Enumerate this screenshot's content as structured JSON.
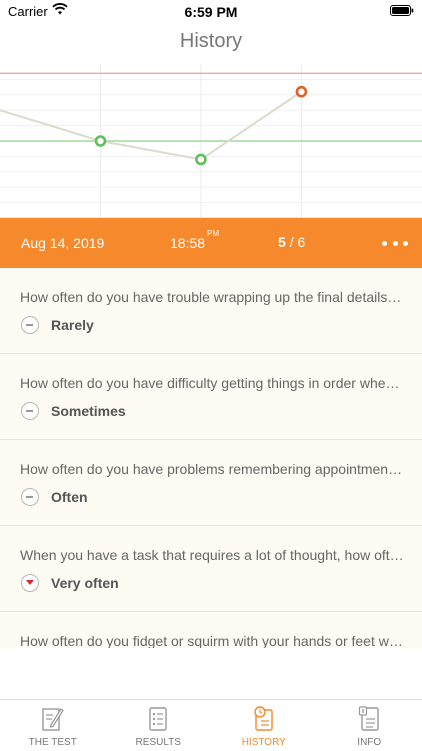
{
  "status_bar": {
    "carrier": "Carrier",
    "time": "6:59 PM"
  },
  "header": {
    "title": "History"
  },
  "chart_data": {
    "type": "line",
    "x": [
      0,
      1,
      2,
      3
    ],
    "values": [
      2,
      1.4,
      3.6
    ],
    "points": [
      {
        "x": 1,
        "y": 2,
        "color": "#5cc05c"
      },
      {
        "x": 2,
        "y": 1.4,
        "color": "#5cc05c"
      },
      {
        "x": 3,
        "y": 3.6,
        "color": "#e0622a"
      }
    ],
    "start_y": 3.0,
    "ylim": [
      -0.5,
      4.5
    ],
    "xlim": [
      0,
      4.2
    ],
    "reference_lines": [
      {
        "y": 4.2,
        "color": "#f0a090"
      },
      {
        "y": 2.0,
        "color": "#8fd08f"
      }
    ],
    "grid": true
  },
  "session": {
    "date": "Aug 14, 2019",
    "time": "18:58",
    "time_suffix": "PM",
    "score_value": "5",
    "score_total": "/ 6"
  },
  "questions": [
    {
      "text": "How often do you have trouble wrapping up the final details of a project, once the challenging parts have been done?",
      "answer": "Rarely",
      "icon": "minus"
    },
    {
      "text": "How often do you have difficulty getting things in order when you have to do a task that requires organization?",
      "answer": "Sometimes",
      "icon": "minus"
    },
    {
      "text": "How often do you have problems remembering appointments or obligations?",
      "answer": "Often",
      "icon": "minus"
    },
    {
      "text": "When you have a task that requires a lot of thought, how often do you avoid or delay getting started?",
      "answer": "Very often",
      "icon": "down"
    },
    {
      "text": "How often do you fidget or squirm with your hands or feet when you have to sit down for a long time?",
      "answer": "",
      "icon": "minus"
    }
  ],
  "tabs": [
    {
      "label": "THE TEST",
      "icon": "pencil-note-icon",
      "active": false
    },
    {
      "label": "RESULTS",
      "icon": "list-document-icon",
      "active": false
    },
    {
      "label": "HISTORY",
      "icon": "clock-document-icon",
      "active": true
    },
    {
      "label": "INFO",
      "icon": "info-document-icon",
      "active": false
    }
  ],
  "colors": {
    "accent": "#f5892b",
    "green": "#5cc05c",
    "red": "#e0622a"
  }
}
